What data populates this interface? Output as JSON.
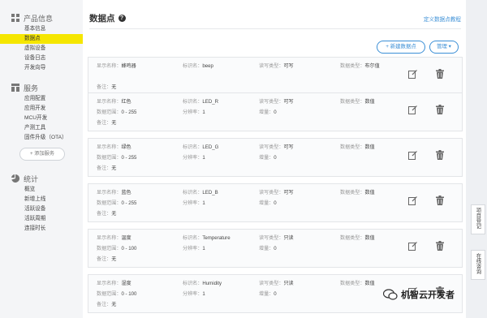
{
  "sidebar": {
    "product": {
      "title": "产品信息",
      "items": [
        "基本信息",
        "数据点",
        "虚拟设备",
        "设备日志",
        "开发向导"
      ]
    },
    "services": {
      "title": "服务",
      "items": [
        "应用配置",
        "应用开发",
        "MCU开发",
        "产测工具",
        "固件升级（OTA）"
      ],
      "add_label": "+ 添加服务"
    },
    "stats": {
      "title": "统计",
      "items": [
        "概览",
        "新增上线",
        "活跃设备",
        "活跃周期",
        "连接时长"
      ]
    }
  },
  "main": {
    "title": "数据点",
    "help_glyph": "?",
    "def_link": "定义数据点教程",
    "new_button": "+ 新建数据点",
    "manage_button": "管理 ▾"
  },
  "datapoints": [
    {
      "display_name": "显示名称：",
      "name": "蜂鸣器",
      "id_label": "标识名：",
      "id": "beep",
      "rw_label": "读写类型：",
      "rw": "可写",
      "type_label": "数据类型：",
      "type": "布尔值",
      "range_label": "",
      "range": "",
      "res_label": "",
      "res": "",
      "inc_label": "",
      "inc": "",
      "note_label": "备注：",
      "note": "无"
    },
    {
      "display_name": "显示名称：",
      "name": "红色",
      "id_label": "标识名：",
      "id": "LED_R",
      "rw_label": "读写类型：",
      "rw": "可写",
      "type_label": "数据类型：",
      "type": "数值",
      "range_label": "数据范围：",
      "range": "0 - 255",
      "res_label": "分辨率：",
      "res": "1",
      "inc_label": "增量：",
      "inc": "0",
      "note_label": "备注：",
      "note": "无"
    },
    {
      "display_name": "显示名称：",
      "name": "绿色",
      "id_label": "标识名：",
      "id": "LED_G",
      "rw_label": "读写类型：",
      "rw": "可写",
      "type_label": "数据类型：",
      "type": "数值",
      "range_label": "数据范围：",
      "range": "0 - 255",
      "res_label": "分辨率：",
      "res": "1",
      "inc_label": "增量：",
      "inc": "0",
      "note_label": "备注：",
      "note": "无"
    },
    {
      "display_name": "显示名称：",
      "name": "蓝色",
      "id_label": "标识名：",
      "id": "LED_B",
      "rw_label": "读写类型：",
      "rw": "可写",
      "type_label": "数据类型：",
      "type": "数值",
      "range_label": "数据范围：",
      "range": "0 - 255",
      "res_label": "分辨率：",
      "res": "1",
      "inc_label": "增量：",
      "inc": "0",
      "note_label": "备注：",
      "note": "无"
    },
    {
      "display_name": "显示名称：",
      "name": "温度",
      "id_label": "标识名：",
      "id": "Temperature",
      "rw_label": "读写类型：",
      "rw": "只读",
      "type_label": "数据类型：",
      "type": "数值",
      "range_label": "数据范围：",
      "range": "0 - 100",
      "res_label": "分辨率：",
      "res": "1",
      "inc_label": "增量：",
      "inc": "0",
      "note_label": "备注：",
      "note": "无"
    },
    {
      "display_name": "显示名称：",
      "name": "湿度",
      "id_label": "标识名：",
      "id": "Humidity",
      "rw_label": "读写类型：",
      "rw": "只读",
      "type_label": "数据类型：",
      "type": "数值",
      "range_label": "数据范围：",
      "range": "0 - 100",
      "res_label": "分辨率：",
      "res": "1",
      "inc_label": "增量：",
      "inc": "0",
      "note_label": "备注：",
      "note": "无"
    }
  ],
  "right_tabs": [
    "项目登记",
    "在线咨询"
  ],
  "watermark": "机智云开发者",
  "colors": {
    "active_nav": "#f5e600",
    "link": "#3b8fd6"
  }
}
